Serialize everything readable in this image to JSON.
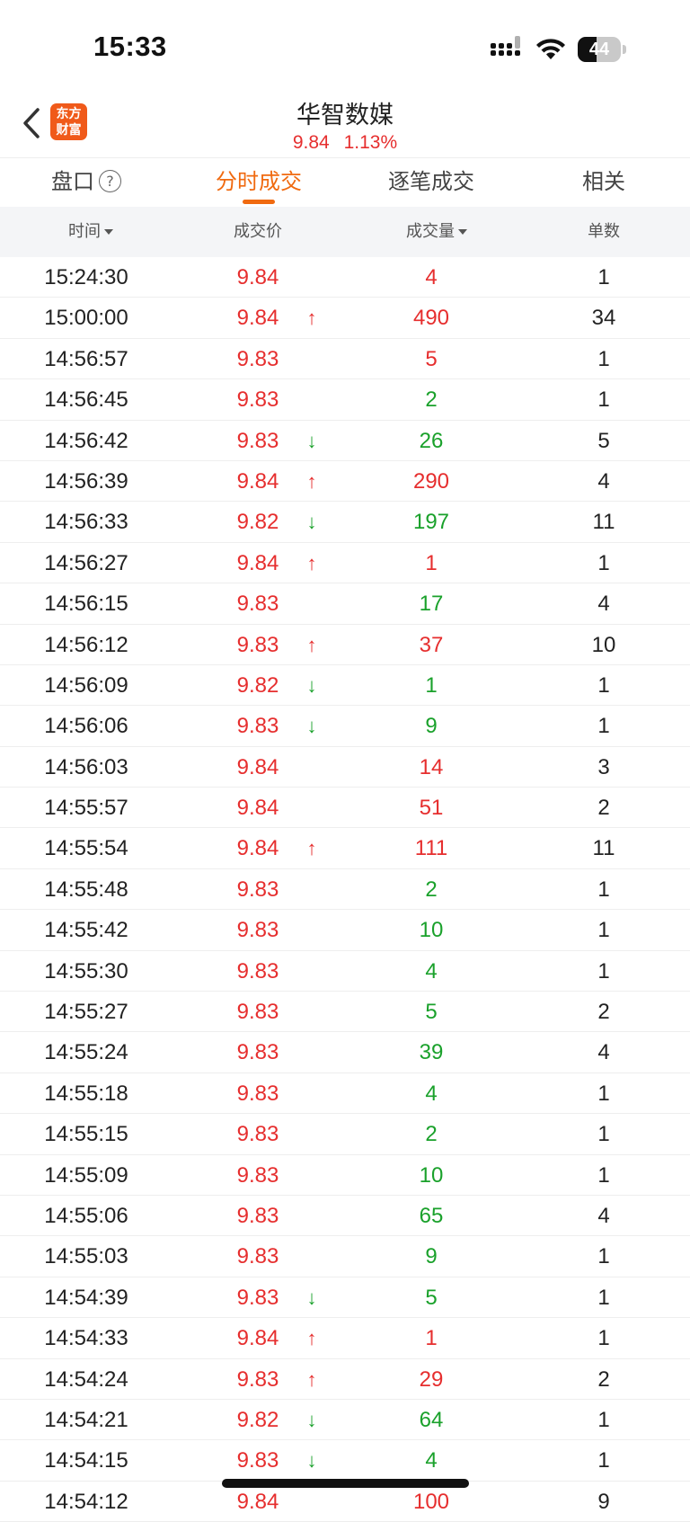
{
  "status_bar": {
    "time": "15:33",
    "battery": "44",
    "battery_level": 0.44
  },
  "header": {
    "logo_line1": "东方",
    "logo_line2": "财富",
    "title": "华智数媒",
    "price": "9.84",
    "change": "1.13%"
  },
  "tabs": [
    {
      "label": "盘口"
    },
    {
      "label": "分时成交"
    },
    {
      "label": "逐笔成交"
    },
    {
      "label": "相关"
    }
  ],
  "help_glyph": "?",
  "columns": {
    "time": "时间",
    "price": "成交价",
    "volume": "成交量",
    "count": "单数"
  },
  "colors": {
    "up": "#e62e2e",
    "down": "#1aa12b",
    "accent": "#f06a10"
  },
  "trades": [
    {
      "time": "15:24:30",
      "price": "9.84",
      "arrow": "",
      "volume": "4",
      "vol_color": "red",
      "count": "1"
    },
    {
      "time": "15:00:00",
      "price": "9.84",
      "arrow": "up",
      "volume": "490",
      "vol_color": "red",
      "count": "34"
    },
    {
      "time": "14:56:57",
      "price": "9.83",
      "arrow": "",
      "volume": "5",
      "vol_color": "red",
      "count": "1"
    },
    {
      "time": "14:56:45",
      "price": "9.83",
      "arrow": "",
      "volume": "2",
      "vol_color": "green",
      "count": "1"
    },
    {
      "time": "14:56:42",
      "price": "9.83",
      "arrow": "down",
      "volume": "26",
      "vol_color": "green",
      "count": "5"
    },
    {
      "time": "14:56:39",
      "price": "9.84",
      "arrow": "up",
      "volume": "290",
      "vol_color": "red",
      "count": "4"
    },
    {
      "time": "14:56:33",
      "price": "9.82",
      "arrow": "down",
      "volume": "197",
      "vol_color": "green",
      "count": "11"
    },
    {
      "time": "14:56:27",
      "price": "9.84",
      "arrow": "up",
      "volume": "1",
      "vol_color": "red",
      "count": "1"
    },
    {
      "time": "14:56:15",
      "price": "9.83",
      "arrow": "",
      "volume": "17",
      "vol_color": "green",
      "count": "4"
    },
    {
      "time": "14:56:12",
      "price": "9.83",
      "arrow": "up",
      "volume": "37",
      "vol_color": "red",
      "count": "10"
    },
    {
      "time": "14:56:09",
      "price": "9.82",
      "arrow": "down",
      "volume": "1",
      "vol_color": "green",
      "count": "1"
    },
    {
      "time": "14:56:06",
      "price": "9.83",
      "arrow": "down",
      "volume": "9",
      "vol_color": "green",
      "count": "1"
    },
    {
      "time": "14:56:03",
      "price": "9.84",
      "arrow": "",
      "volume": "14",
      "vol_color": "red",
      "count": "3"
    },
    {
      "time": "14:55:57",
      "price": "9.84",
      "arrow": "",
      "volume": "51",
      "vol_color": "red",
      "count": "2"
    },
    {
      "time": "14:55:54",
      "price": "9.84",
      "arrow": "up",
      "volume": "111",
      "vol_color": "red",
      "count": "11"
    },
    {
      "time": "14:55:48",
      "price": "9.83",
      "arrow": "",
      "volume": "2",
      "vol_color": "green",
      "count": "1"
    },
    {
      "time": "14:55:42",
      "price": "9.83",
      "arrow": "",
      "volume": "10",
      "vol_color": "green",
      "count": "1"
    },
    {
      "time": "14:55:30",
      "price": "9.83",
      "arrow": "",
      "volume": "4",
      "vol_color": "green",
      "count": "1"
    },
    {
      "time": "14:55:27",
      "price": "9.83",
      "arrow": "",
      "volume": "5",
      "vol_color": "green",
      "count": "2"
    },
    {
      "time": "14:55:24",
      "price": "9.83",
      "arrow": "",
      "volume": "39",
      "vol_color": "green",
      "count": "4"
    },
    {
      "time": "14:55:18",
      "price": "9.83",
      "arrow": "",
      "volume": "4",
      "vol_color": "green",
      "count": "1"
    },
    {
      "time": "14:55:15",
      "price": "9.83",
      "arrow": "",
      "volume": "2",
      "vol_color": "green",
      "count": "1"
    },
    {
      "time": "14:55:09",
      "price": "9.83",
      "arrow": "",
      "volume": "10",
      "vol_color": "green",
      "count": "1"
    },
    {
      "time": "14:55:06",
      "price": "9.83",
      "arrow": "",
      "volume": "65",
      "vol_color": "green",
      "count": "4"
    },
    {
      "time": "14:55:03",
      "price": "9.83",
      "arrow": "",
      "volume": "9",
      "vol_color": "green",
      "count": "1"
    },
    {
      "time": "14:54:39",
      "price": "9.83",
      "arrow": "down",
      "volume": "5",
      "vol_color": "green",
      "count": "1"
    },
    {
      "time": "14:54:33",
      "price": "9.84",
      "arrow": "up",
      "volume": "1",
      "vol_color": "red",
      "count": "1"
    },
    {
      "time": "14:54:24",
      "price": "9.83",
      "arrow": "up",
      "volume": "29",
      "vol_color": "red",
      "count": "2"
    },
    {
      "time": "14:54:21",
      "price": "9.82",
      "arrow": "down",
      "volume": "64",
      "vol_color": "green",
      "count": "1"
    },
    {
      "time": "14:54:15",
      "price": "9.83",
      "arrow": "down",
      "volume": "4",
      "vol_color": "green",
      "count": "1"
    },
    {
      "time": "14:54:12",
      "price": "9.84",
      "arrow": "",
      "volume": "100",
      "vol_color": "red",
      "count": "9"
    }
  ]
}
